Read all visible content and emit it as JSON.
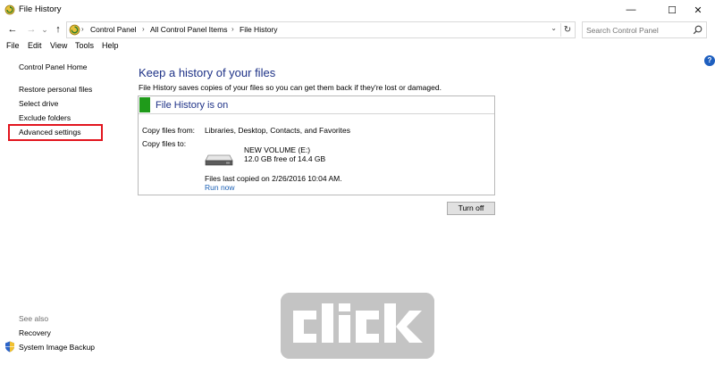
{
  "window": {
    "title": "File History",
    "minimize_glyph": "—",
    "maximize_glyph": "☐",
    "close_glyph": "✕"
  },
  "navigation": {
    "back_glyph": "←",
    "forward_glyph": "→",
    "recent_glyph": "⌄",
    "up_glyph": "↑"
  },
  "address": {
    "crumbs": [
      "Control Panel",
      "All Control Panel Items",
      "File History"
    ],
    "separator": "›",
    "dropdown_glyph": "⌄",
    "refresh_glyph": "↻"
  },
  "search": {
    "placeholder": "Search Control Panel"
  },
  "menu": [
    "File",
    "Edit",
    "View",
    "Tools",
    "Help"
  ],
  "sidebar": {
    "home": "Control Panel Home",
    "links": [
      "Restore personal files",
      "Select drive",
      "Exclude folders",
      "Advanced settings"
    ],
    "see_also_heading": "See also",
    "see_also_links": [
      "Recovery",
      "System Image Backup"
    ]
  },
  "main": {
    "title": "Keep a history of your files",
    "description": "File History saves copies of your files so you can get them back if they're lost or damaged.",
    "status": "File History is on",
    "copy_from_label": "Copy files from:",
    "copy_from_value": "Libraries, Desktop, Contacts, and Favorites",
    "copy_to_label": "Copy files to:",
    "drive_name": "NEW VOLUME (E:)",
    "drive_free": "12.0 GB free of 14.4 GB",
    "last_copied": "Files last copied on 2/26/2016 10:04 AM.",
    "run_now": "Run now",
    "turn_off": "Turn off"
  },
  "help_glyph": "?",
  "watermark": {
    "text": "click"
  },
  "colors": {
    "status_green": "#1f9b1a",
    "title_blue": "#1e3287",
    "link_blue": "#1a5fb4",
    "highlight_red": "#e2151e"
  },
  "icons": {
    "app": "file-history-icon",
    "search": "search-icon",
    "drive": "hard-drive-icon",
    "shield": "uac-shield-icon",
    "help": "help-icon"
  }
}
